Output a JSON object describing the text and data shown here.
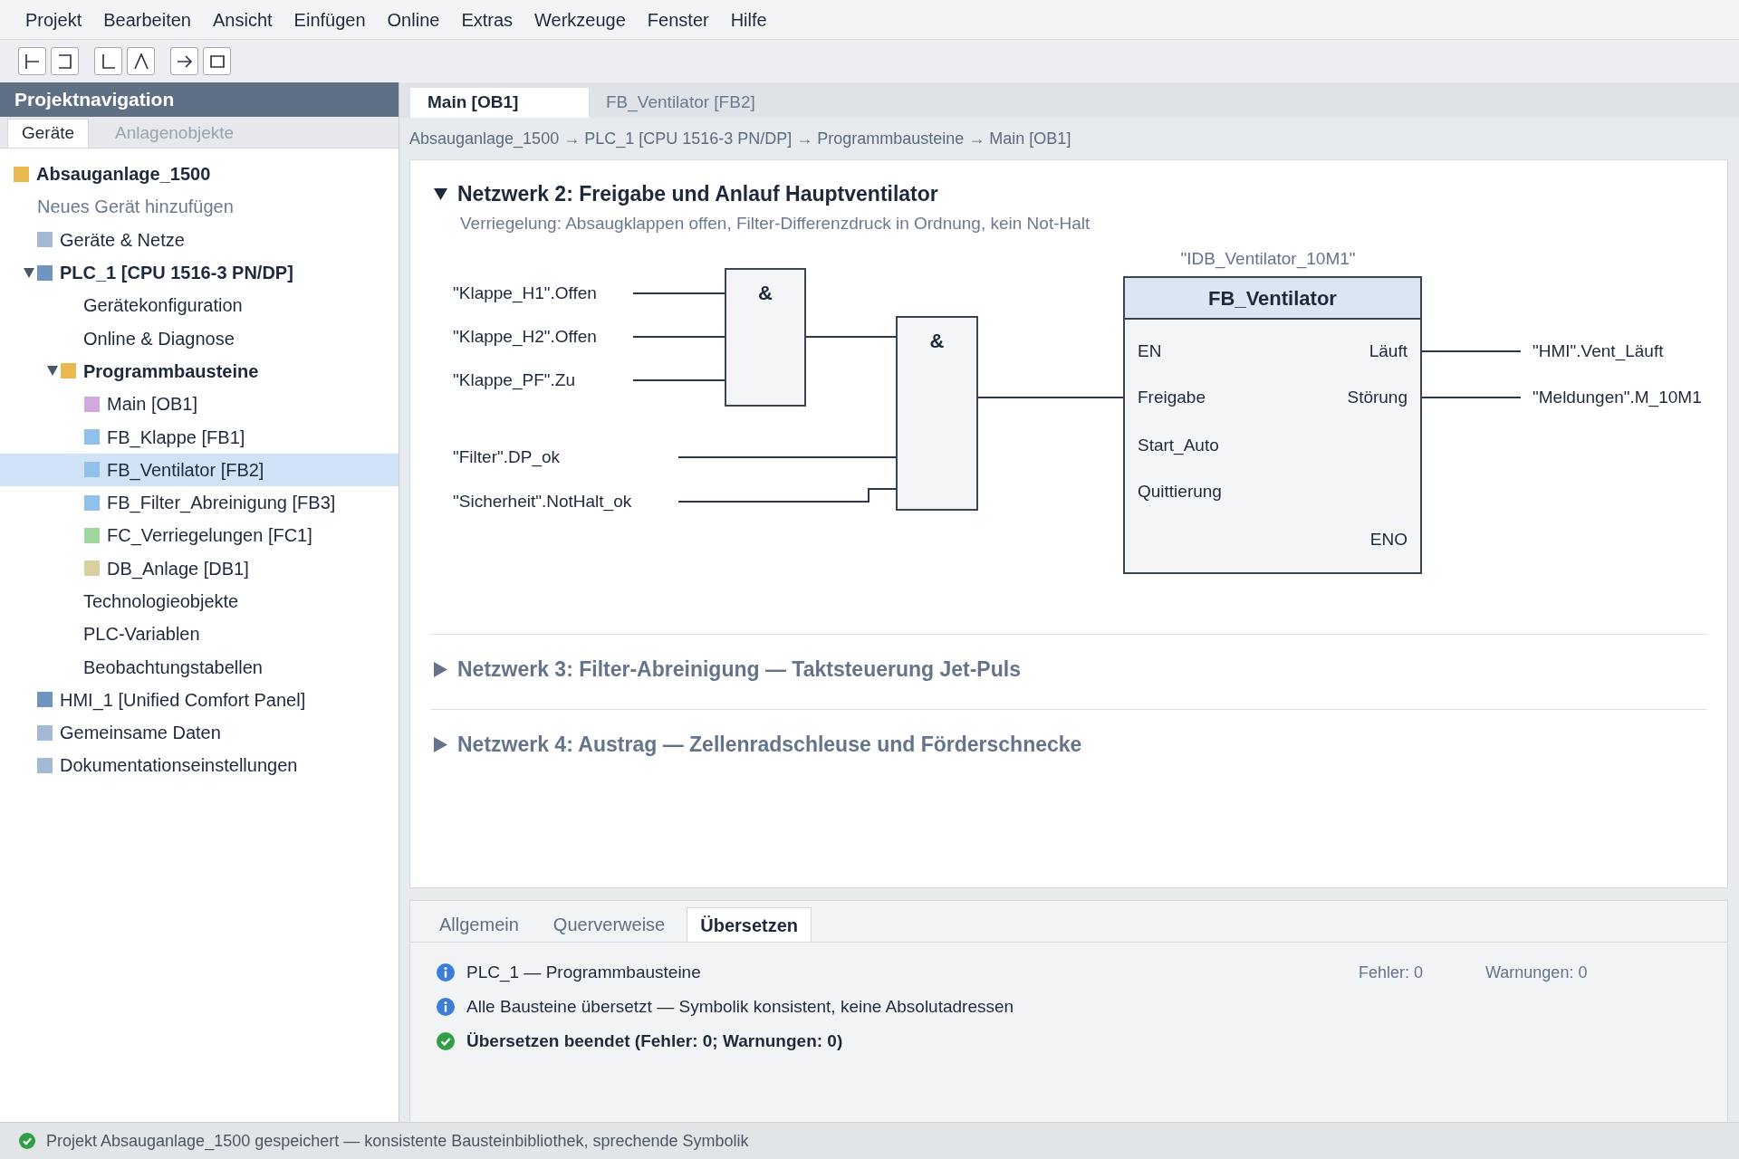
{
  "menu_bar": [
    "Projekt",
    "Bearbeiten",
    "Ansicht",
    "Einfügen",
    "Online",
    "Extras",
    "Werkzeuge",
    "Fenster",
    "Hilfe"
  ],
  "sidebar": {
    "title": "Projektnavigation",
    "tabs": [
      {
        "label": "Geräte",
        "selected": true
      },
      {
        "label": "Anlagenobjekte",
        "selected": false
      }
    ],
    "tree": [
      {
        "label": "Absauganlage_1500",
        "kind": "project",
        "color": "#eab84e",
        "selected": false,
        "children": [
          {
            "label": "Neues Gerät hinzufügen",
            "kind": "action",
            "selected": false
          },
          {
            "label": "Geräte & Netze",
            "kind": "node",
            "color": "#a3bad6",
            "selected": false
          },
          {
            "label": "PLC_1 [CPU 1516-3 PN/DP]",
            "kind": "node",
            "color": "#7094c0",
            "expanded": true,
            "selected": false,
            "children": [
              {
                "label": "Gerätekonfiguration",
                "kind": "node",
                "selected": false
              },
              {
                "label": "Online & Diagnose",
                "kind": "node",
                "selected": false
              },
              {
                "label": "Programmbausteine",
                "kind": "node",
                "color": "#eab84e",
                "expanded": true,
                "selected": false,
                "children": [
                  {
                    "label": "Main [OB1]",
                    "kind": "node",
                    "color": "#d3a8e0",
                    "selected": false
                  },
                  {
                    "label": "FB_Klappe [FB1]",
                    "kind": "node",
                    "color": "#8fc1ea",
                    "selected": false
                  },
                  {
                    "label": "FB_Ventilator [FB2]",
                    "kind": "node",
                    "color": "#8fc1ea",
                    "selected": true
                  },
                  {
                    "label": "FB_Filter_Abreinigung [FB3]",
                    "kind": "node",
                    "color": "#8fc1ea",
                    "selected": false
                  },
                  {
                    "label": "FC_Verriegelungen [FC1]",
                    "kind": "node",
                    "color": "#9fd69b",
                    "selected": false
                  },
                  {
                    "label": "DB_Anlage [DB1]",
                    "kind": "node",
                    "color": "#d8cf9f",
                    "selected": false
                  }
                ]
              },
              {
                "label": "Technologieobjekte",
                "kind": "node",
                "selected": false
              },
              {
                "label": "PLC-Variablen",
                "kind": "node",
                "selected": false
              },
              {
                "label": "Beobachtungstabellen",
                "kind": "node",
                "selected": false
              }
            ]
          },
          {
            "label": "HMI_1 [Unified Comfort Panel]",
            "kind": "node",
            "color": "#7094c0",
            "selected": false
          },
          {
            "label": "Gemeinsame Daten",
            "kind": "node",
            "color": "#a3bad6",
            "selected": false
          },
          {
            "label": "Dokumentationseinstellungen",
            "kind": "node",
            "color": "#a3bad6",
            "selected": false
          }
        ]
      }
    ]
  },
  "editor": {
    "tabs": [
      {
        "label": "Main [OB1]",
        "selected": true
      },
      {
        "label": "FB_Ventilator [FB2]",
        "selected": false
      }
    ],
    "breadcrumb": "Absauganlage_1500 → PLC_1 [CPU 1516-3 PN/DP] → Programmbausteine → Main [OB1]",
    "networks": [
      {
        "title": "Netzwerk 2: Freigabe und Anlauf Hauptventilator",
        "expanded": true,
        "comment": "Verriegelung: Absaugklappen offen, Filter-Differenzdruck in Ordnung, kein Not-Halt",
        "diagram": {
          "inputs": [
            "\"Klappe_H1\".Offen",
            "\"Klappe_H2\".Offen",
            "\"Klappe_PF\".Zu",
            "\"Filter\".DP_ok",
            "\"Sicherheit\".NotHalt_ok"
          ],
          "gates": [
            "&",
            "&"
          ],
          "block": {
            "instance": "\"IDB_Ventilator_10M1\"",
            "title": "FB_Ventilator",
            "inputs": [
              "EN",
              "Freigabe",
              "Start_Auto",
              "Quittierung"
            ],
            "outputs": [
              "Läuft",
              "Störung"
            ],
            "eno": "ENO"
          },
          "outputs": [
            "\"HMI\".Vent_Läuft",
            "\"Meldungen\".M_10M1"
          ]
        }
      },
      {
        "title": "Netzwerk 3: Filter-Abreinigung — Taktsteuerung Jet-Puls",
        "expanded": false
      },
      {
        "title": "Netzwerk 4: Austrag — Zellenradschleuse und Förderschnecke",
        "expanded": false
      }
    ]
  },
  "output_panel": {
    "tabs": [
      {
        "label": "Allgemein",
        "selected": false
      },
      {
        "label": "Querverweise",
        "selected": false
      },
      {
        "label": "Übersetzen",
        "selected": true
      }
    ],
    "messages": [
      {
        "kind": "info",
        "text": "PLC_1 — Programmbausteine",
        "errors": "Fehler: 0",
        "warnings": "Warnungen: 0"
      },
      {
        "kind": "info",
        "text": "Alle Bausteine übersetzt — Symbolik konsistent, keine Absolutadressen"
      },
      {
        "kind": "success",
        "text": "Übersetzen beendet (Fehler: 0; Warnungen: 0)"
      }
    ]
  },
  "status_bar": {
    "text": "Projekt Absauganlage_1500 gespeichert — konsistente Bausteinbibliothek, sprechende Symbolik"
  }
}
